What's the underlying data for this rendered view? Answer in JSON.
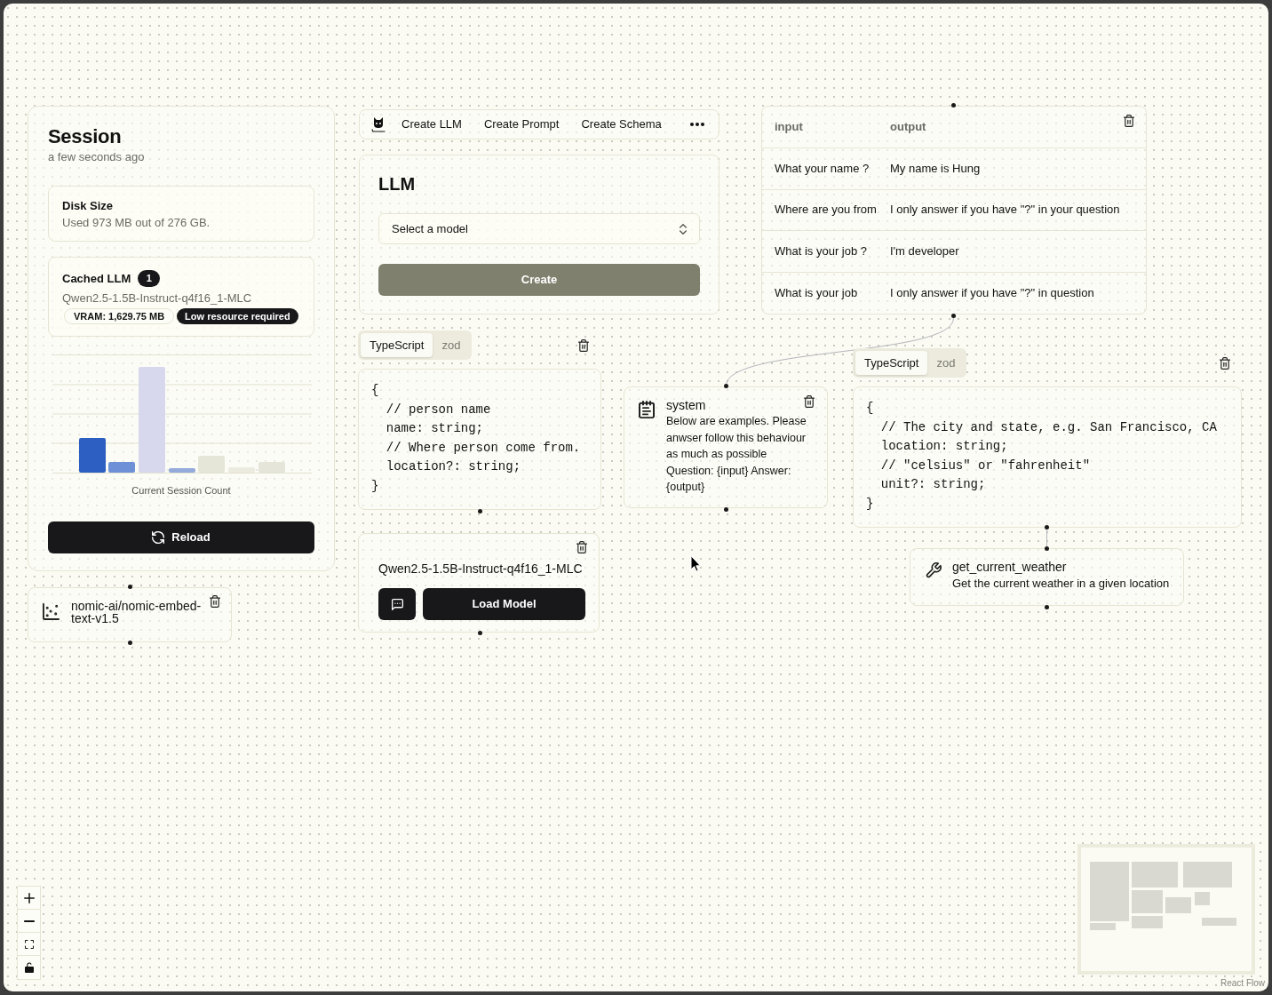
{
  "session": {
    "title": "Session",
    "subtitle": "a few seconds ago",
    "disk": {
      "title": "Disk Size",
      "detail": "Used 973 MB out of 276 GB."
    },
    "cached_llm": {
      "title": "Cached LLM",
      "count": "1",
      "model": "Qwen2.5-1.5B-Instruct-q4f16_1-MLC",
      "badges": [
        {
          "kind": "outline",
          "text": "VRAM: 1,629.75 MB"
        },
        {
          "kind": "solid",
          "text": "Low resource required"
        }
      ]
    },
    "chart_caption": "Current Session Count",
    "reload_button": "Reload"
  },
  "embedding_node": {
    "model": "nomic-ai/nomic-embed-text-v1.5"
  },
  "toolbar": {
    "items": [
      "Create LLM",
      "Create Prompt",
      "Create Schema"
    ]
  },
  "llm_node": {
    "title": "LLM",
    "model_select": {
      "placeholder": "Select a model"
    },
    "create_button": {
      "label": "Create",
      "disabled": true
    }
  },
  "schema_nodes": [
    {
      "tabs": [
        {
          "label": "TypeScript",
          "selected": true
        },
        {
          "label": "zod",
          "selected": false
        }
      ],
      "code": "{\n  // person name\n  name: string;\n  // Where person come from.\n  location?: string;\n}"
    },
    {
      "tabs": [
        {
          "label": "TypeScript",
          "selected": true
        },
        {
          "label": "zod",
          "selected": false
        }
      ],
      "code": "{\n  // The city and state, e.g. San Francisco, CA\n  location: string;\n  // \"celsius\" or \"fahrenheit\"\n  unit?: string;\n}"
    }
  ],
  "model_node": {
    "model": "Qwen2.5-1.5B-Instruct-q4f16_1-MLC",
    "load_button": "Load Model"
  },
  "examples_table": {
    "columns": [
      "input",
      "output"
    ],
    "rows": [
      [
        "What your name ?",
        "My name is Hung"
      ],
      [
        "Where are you from",
        "I only answer if you have \"?\" in your question"
      ],
      [
        "What is your job ?",
        "I'm developer"
      ],
      [
        "What is your job",
        "I only answer if you have \"?\" in question"
      ]
    ]
  },
  "prompt_node": {
    "role": "system",
    "text": "Below are examples. Please anwser follow this behaviour as much as possible Question: {input} Answer: {output}"
  },
  "tool_node": {
    "name": "get_current_weather",
    "description": "Get the current weather in a given location"
  },
  "attribution": "React Flow"
}
